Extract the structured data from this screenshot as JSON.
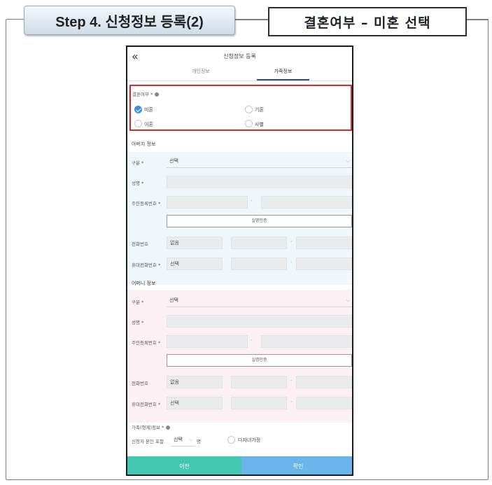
{
  "header": {
    "step_label": "Step 4. 신청정보 등록(2)",
    "callout_label": "결혼여부 – 미혼 선택"
  },
  "phone": {
    "back_glyph": "«",
    "title": "신청정보 등록",
    "tabs": [
      {
        "label": "개인정보",
        "active": false
      },
      {
        "label": "가족정보",
        "active": true
      }
    ],
    "marital": {
      "label": "결혼여부 *",
      "options": [
        {
          "label": "미혼",
          "checked": true
        },
        {
          "label": "기혼",
          "checked": false
        },
        {
          "label": "이혼",
          "checked": false
        },
        {
          "label": "사별",
          "checked": false
        }
      ]
    },
    "father": {
      "title": "아버지 정보",
      "type_label": "구분 *",
      "type_value": "선택",
      "name_label": "성명 *",
      "rrn_label": "주민등록번호 *",
      "verify_button": "실명인증",
      "phone_label": "전화번호",
      "phone_value": "없음",
      "mobile_label": "휴대전화번호 *",
      "mobile_value": "선택"
    },
    "mother": {
      "title": "어머니 정보",
      "type_label": "구분 *",
      "type_value": "선택",
      "name_label": "성명 *",
      "rrn_label": "주민등록번호 *",
      "verify_button": "실명인증",
      "phone_label": "전화번호",
      "phone_value": "없음",
      "mobile_label": "휴대전화번호 *",
      "mobile_value": "선택"
    },
    "family": {
      "title": "가족(형제)정보 *",
      "include_label": "신청자 본인 포함",
      "count_value": "선택",
      "unit": "명",
      "multi_child_label": "다자녀가정"
    },
    "buttons": {
      "prev": "이전",
      "confirm": "확인"
    }
  },
  "colors": {
    "prev_button": "#44c7b1",
    "confirm_button": "#69b4ea",
    "highlight_border": "#d82b2b",
    "checked_radio": "#3b8fe0"
  }
}
